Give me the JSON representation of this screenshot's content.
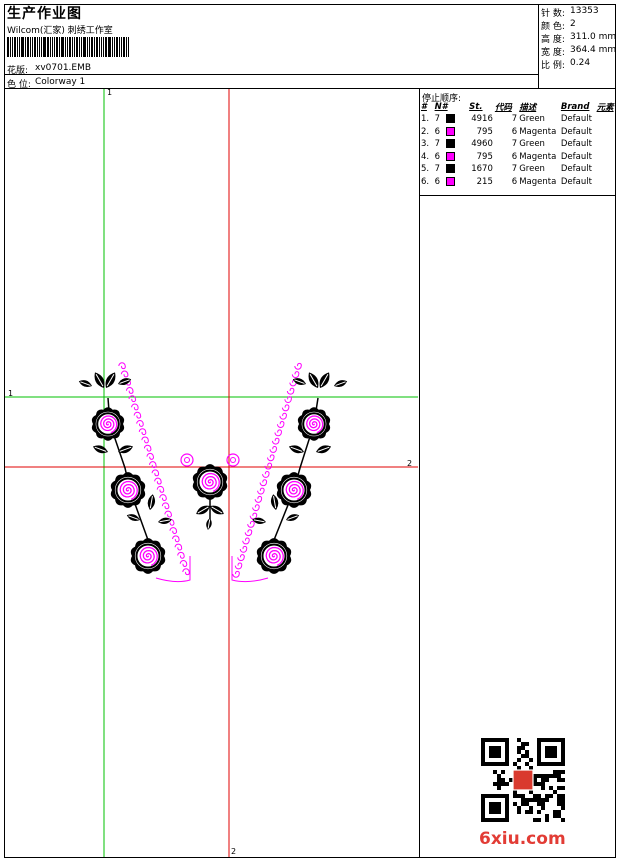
{
  "header": {
    "title": "生产作业图",
    "company": "Wilcom(汇家) 刺绣工作室",
    "design_label": "花版:",
    "design_value": "xv0701.EMB",
    "colorway_label": "色 位:",
    "colorway_value": "Colorway 1"
  },
  "stats": {
    "stitches_label": "针 数:",
    "stitches_value": "13353",
    "colors_label": "颜 色:",
    "colors_value": "2",
    "height_label": "高 度:",
    "height_value": "311.0 mm",
    "width_label": "宽 度:",
    "width_value": "364.4 mm",
    "scale_label": "比 例:",
    "scale_value": "0.24"
  },
  "sequence": {
    "title": "停止顺序:",
    "headers": [
      "#",
      "N#",
      "St.",
      "代码",
      "描述",
      "Brand",
      "元素"
    ],
    "rows": [
      {
        "idx": "1.",
        "needle": "7",
        "color": "#000000",
        "stitches": "4916",
        "code": "7",
        "desc": "Green",
        "brand": "Default"
      },
      {
        "idx": "2.",
        "needle": "6",
        "color": "#ff00ff",
        "stitches": "795",
        "code": "6",
        "desc": "Magenta",
        "brand": "Default"
      },
      {
        "idx": "3.",
        "needle": "7",
        "color": "#000000",
        "stitches": "4960",
        "code": "7",
        "desc": "Green",
        "brand": "Default"
      },
      {
        "idx": "4.",
        "needle": "6",
        "color": "#ff00ff",
        "stitches": "795",
        "code": "6",
        "desc": "Magenta",
        "brand": "Default"
      },
      {
        "idx": "5.",
        "needle": "7",
        "color": "#000000",
        "stitches": "1670",
        "code": "7",
        "desc": "Green",
        "brand": "Default"
      },
      {
        "idx": "6.",
        "needle": "6",
        "color": "#ff00ff",
        "stitches": "215",
        "code": "6",
        "desc": "Magenta",
        "brand": "Default"
      }
    ]
  },
  "canvas": {
    "axis_labels": {
      "top_green": "1",
      "left_green": "1",
      "right_red": "2",
      "bottom_red": "2"
    },
    "guide_colors": {
      "green": "#00c000",
      "red": "#e00000"
    }
  },
  "colors": {
    "thread_black": "#000000",
    "thread_magenta": "#ff00ff"
  },
  "watermark": {
    "logo_text": "6xiu.com"
  }
}
